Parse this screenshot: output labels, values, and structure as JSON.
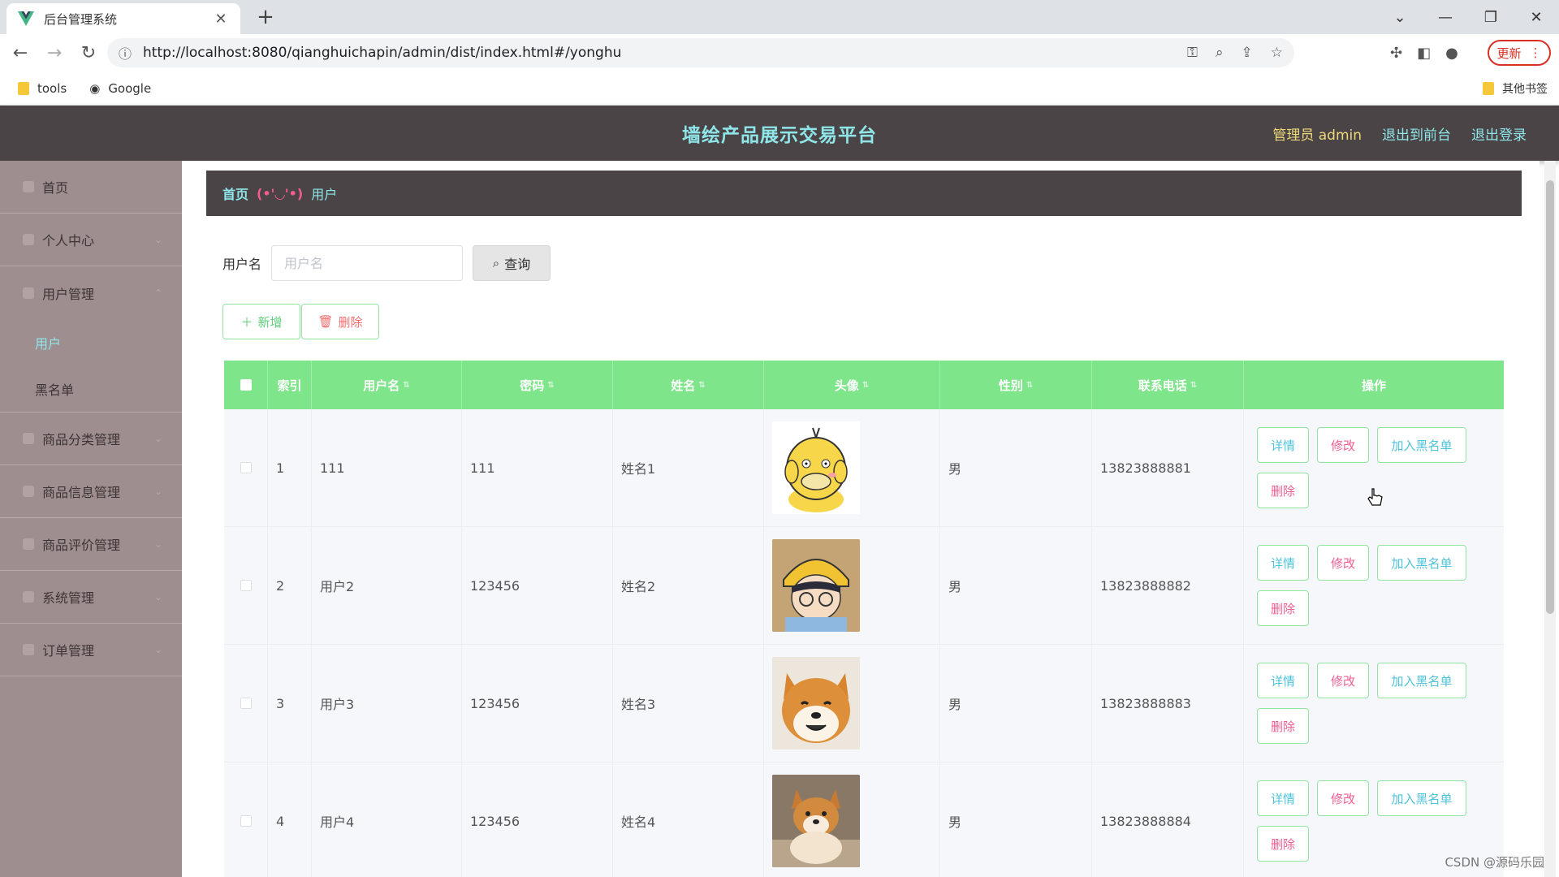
{
  "browser": {
    "tab_title": "后台管理系统",
    "url": "http://localhost:8080/qianghuichapin/admin/dist/index.html#/yonghu",
    "update_label": "更新",
    "bookmarks": [
      {
        "label": "tools"
      },
      {
        "label": "Google"
      }
    ],
    "other_bookmarks": "其他书签"
  },
  "header": {
    "title": "墙绘产品展示交易平台",
    "user": "管理员 admin",
    "front_link": "退出到前台",
    "logout_link": "退出登录"
  },
  "sidebar": {
    "items": [
      {
        "label": "首页"
      },
      {
        "label": "个人中心"
      },
      {
        "label": "用户管理"
      },
      {
        "label": "商品分类管理"
      },
      {
        "label": "商品信息管理"
      },
      {
        "label": "商品评价管理"
      },
      {
        "label": "系统管理"
      },
      {
        "label": "订单管理"
      }
    ],
    "sub_items": [
      {
        "label": "用户"
      },
      {
        "label": "黑名单"
      }
    ]
  },
  "breadcrumb": {
    "home": "首页",
    "separator": "(•'◡'•)",
    "current": "用户"
  },
  "search": {
    "label": "用户名",
    "placeholder": "用户名",
    "button": "查询"
  },
  "actions": {
    "add": "新增",
    "delete": "删除"
  },
  "table": {
    "columns": [
      "索引",
      "用户名",
      "密码",
      "姓名",
      "头像",
      "性别",
      "联系电话",
      "操作"
    ],
    "ops": {
      "detail": "详情",
      "edit": "修改",
      "blacklist": "加入黑名单",
      "delete": "删除"
    },
    "rows": [
      {
        "index": "1",
        "username": "111",
        "password": "111",
        "name": "姓名1",
        "avatar": "psyduck",
        "gender": "男",
        "phone": "13823888881"
      },
      {
        "index": "2",
        "username": "用户2",
        "password": "123456",
        "name": "姓名2",
        "avatar": "cartoon-boy",
        "gender": "男",
        "phone": "13823888882"
      },
      {
        "index": "3",
        "username": "用户3",
        "password": "123456",
        "name": "姓名3",
        "avatar": "shiba-smile",
        "gender": "男",
        "phone": "13823888883"
      },
      {
        "index": "4",
        "username": "用户4",
        "password": "123456",
        "name": "姓名4",
        "avatar": "shiba-sitting",
        "gender": "男",
        "phone": "13823888884"
      }
    ]
  },
  "watermark": "CSDN @源码乐园",
  "colors": {
    "header_bg": "#4a4446",
    "accent": "#8fe6e9",
    "table_header": "#7fe58b",
    "sidebar_bg": "#9f8e8f",
    "pink": "#f25c91"
  }
}
